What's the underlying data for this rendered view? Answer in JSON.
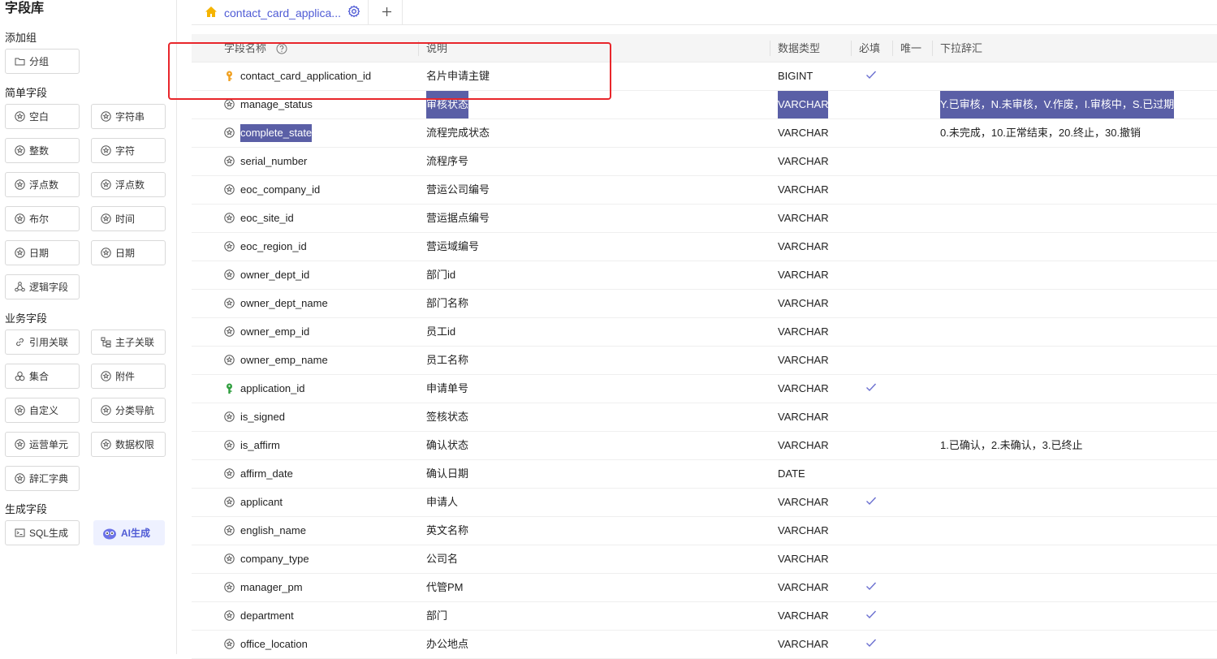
{
  "left_panel": {
    "title": "字段库",
    "sections": {
      "add_group": "添加组",
      "simple": "简单字段",
      "business": "业务字段",
      "generate": "生成字段"
    },
    "buttons": {
      "group": "分组",
      "blank": "空白",
      "string": "字符串",
      "integer": "整数",
      "char": "字符",
      "float1": "浮点数",
      "float2": "浮点数",
      "boolean": "布尔",
      "time": "时间",
      "date1": "日期",
      "date2": "日期",
      "logic": "逻辑字段",
      "ref": "引用关联",
      "master_child": "主子关联",
      "collection": "集合",
      "attachment": "附件",
      "custom": "自定义",
      "category_nav": "分类导航",
      "ops_unit": "运营单元",
      "data_perm": "数据权限",
      "dictionary": "辞汇字典",
      "sql_gen": "SQL生成",
      "ai_gen": "AI生成"
    }
  },
  "tabs": {
    "active": "contact_card_applica...",
    "add": "+"
  },
  "table": {
    "headers": {
      "name": "字段名称",
      "desc": "说明",
      "type": "数据类型",
      "required": "必填",
      "unique": "唯一",
      "dict": "下拉辞汇"
    },
    "check_mark": "✓",
    "rows": [
      {
        "name": "contact_card_application_id",
        "desc": "名片申请主键",
        "type": "BIGINT",
        "required": true,
        "dict": "",
        "icon": "key-gold"
      },
      {
        "name": "manage_status",
        "desc": "审核状态",
        "type": "VARCHAR",
        "required": false,
        "dict": "Y.已审核，N.未审核，V.作废，I.审核中，S.已过期",
        "icon": "field"
      },
      {
        "name": "complete_state",
        "desc": "流程完成状态",
        "type": "VARCHAR",
        "required": false,
        "dict": "0.未完成，10.正常结束，20.终止，30.撤销",
        "icon": "field"
      },
      {
        "name": "serial_number",
        "desc": "流程序号",
        "type": "VARCHAR",
        "required": false,
        "dict": "",
        "icon": "field"
      },
      {
        "name": "eoc_company_id",
        "desc": "营运公司编号",
        "type": "VARCHAR",
        "required": false,
        "dict": "",
        "icon": "field"
      },
      {
        "name": "eoc_site_id",
        "desc": "营运据点编号",
        "type": "VARCHAR",
        "required": false,
        "dict": "",
        "icon": "field"
      },
      {
        "name": "eoc_region_id",
        "desc": "营运域编号",
        "type": "VARCHAR",
        "required": false,
        "dict": "",
        "icon": "field"
      },
      {
        "name": "owner_dept_id",
        "desc": "部门id",
        "type": "VARCHAR",
        "required": false,
        "dict": "",
        "icon": "field"
      },
      {
        "name": "owner_dept_name",
        "desc": "部门名称",
        "type": "VARCHAR",
        "required": false,
        "dict": "",
        "icon": "field"
      },
      {
        "name": "owner_emp_id",
        "desc": "员工id",
        "type": "VARCHAR",
        "required": false,
        "dict": "",
        "icon": "field"
      },
      {
        "name": "owner_emp_name",
        "desc": "员工名称",
        "type": "VARCHAR",
        "required": false,
        "dict": "",
        "icon": "field"
      },
      {
        "name": "application_id",
        "desc": "申请单号",
        "type": "VARCHAR",
        "required": true,
        "dict": "",
        "icon": "key-green"
      },
      {
        "name": "is_signed",
        "desc": "签核状态",
        "type": "VARCHAR",
        "required": false,
        "dict": "",
        "icon": "field"
      },
      {
        "name": "is_affirm",
        "desc": "确认状态",
        "type": "VARCHAR",
        "required": false,
        "dict": "1.已确认，2.未确认，3.已终止",
        "icon": "field"
      },
      {
        "name": "affirm_date",
        "desc": "确认日期",
        "type": "DATE",
        "required": false,
        "dict": "",
        "icon": "field"
      },
      {
        "name": "applicant",
        "desc": "申请人",
        "type": "VARCHAR",
        "required": true,
        "dict": "",
        "icon": "field"
      },
      {
        "name": "english_name",
        "desc": "英文名称",
        "type": "VARCHAR",
        "required": false,
        "dict": "",
        "icon": "field"
      },
      {
        "name": "company_type",
        "desc": "公司名",
        "type": "VARCHAR",
        "required": false,
        "dict": "",
        "icon": "field"
      },
      {
        "name": "manager_pm",
        "desc": "代管PM",
        "type": "VARCHAR",
        "required": true,
        "dict": "",
        "icon": "field"
      },
      {
        "name": "department",
        "desc": "部门",
        "type": "VARCHAR",
        "required": true,
        "dict": "",
        "icon": "field"
      },
      {
        "name": "office_location",
        "desc": "办公地点",
        "type": "VARCHAR",
        "required": true,
        "dict": "",
        "icon": "field"
      }
    ]
  },
  "colors": {
    "accent": "#4f5bd5",
    "selection": "#5a5fa6",
    "annotation": "#e8262b",
    "key_gold": "#f0a020",
    "key_green": "#2f9e3e"
  }
}
